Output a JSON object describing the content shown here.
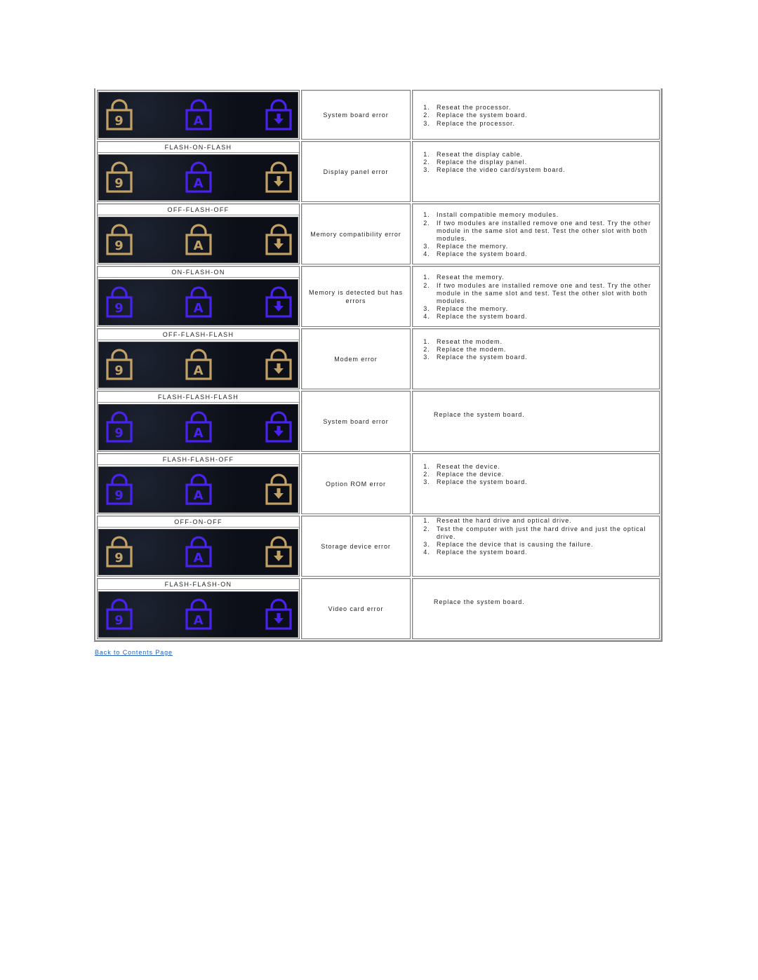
{
  "colors": {
    "led_on": "#4a22f0",
    "led_off": "#c2a165",
    "link": "#1f5fbf"
  },
  "led_icons": [
    "num-lock-icon",
    "caps-lock-icon",
    "scroll-lock-icon"
  ],
  "led_glyphs": [
    "9",
    "A",
    "↓"
  ],
  "rows": [
    {
      "pattern": "",
      "states": [
        "off",
        "on",
        "on"
      ],
      "description": "System board error",
      "fixes": [
        "Reseat the processor.",
        "Replace the system board.",
        "Replace the processor."
      ],
      "fix_align": "top"
    },
    {
      "pattern": "FLASH-ON-FLASH",
      "states": [
        "off",
        "on",
        "off"
      ],
      "description": "Display panel error",
      "fixes": [
        "Reseat the display cable.",
        "Replace the display panel.",
        "Replace the video card/system board."
      ],
      "fix_align": "middle"
    },
    {
      "pattern": "OFF-FLASH-OFF",
      "states": [
        "off",
        "off",
        "off"
      ],
      "description": "Memory compatibility error",
      "fixes": [
        "Install compatible memory modules.",
        "If two modules are installed remove one and test. Try the other module in the same slot and test. Test the other slot with both modules.",
        "Replace the memory.",
        "Replace the system board."
      ],
      "fix_align": "top"
    },
    {
      "pattern": "ON-FLASH-ON",
      "states": [
        "on",
        "on",
        "on"
      ],
      "description": "Memory is detected but has errors",
      "fixes": [
        "Reseat the memory.",
        "If two modules are installed remove one and test. Try the other module in the same slot and test. Test the other slot with both modules.",
        "Replace the memory.",
        "Replace the system board."
      ],
      "fix_align": "top"
    },
    {
      "pattern": "OFF-FLASH-FLASH",
      "states": [
        "off",
        "off",
        "off"
      ],
      "description": "Modem error",
      "fixes": [
        "Reseat the modem.",
        "Replace the modem.",
        "Replace the system board."
      ],
      "fix_align": "middle"
    },
    {
      "pattern": "FLASH-FLASH-FLASH",
      "states": [
        "on",
        "on",
        "on"
      ],
      "description": "System board error",
      "single_fix": "Replace the system board.",
      "fix_align": "middle"
    },
    {
      "pattern": "FLASH-FLASH-OFF",
      "states": [
        "on",
        "on",
        "off"
      ],
      "description": "Option ROM error",
      "fixes": [
        "Reseat the device.",
        "Replace the device.",
        "Replace the system board."
      ],
      "fix_align": "middle"
    },
    {
      "pattern": "OFF-ON-OFF",
      "states": [
        "off",
        "on",
        "off"
      ],
      "description": "Storage device error",
      "fixes": [
        "Reseat the hard drive and optical drive.",
        "Test the computer with just the hard drive and just the optical drive.",
        "Replace the device that is causing the failure.",
        "Replace the system board."
      ],
      "fix_align": "middle"
    },
    {
      "pattern": "FLASH-FLASH-ON",
      "states": [
        "on",
        "on",
        "on"
      ],
      "description": "Video card error",
      "single_fix": "Replace the system board.",
      "fix_align": "middle"
    }
  ],
  "footer": {
    "back_link": "Back to Contents Page"
  }
}
